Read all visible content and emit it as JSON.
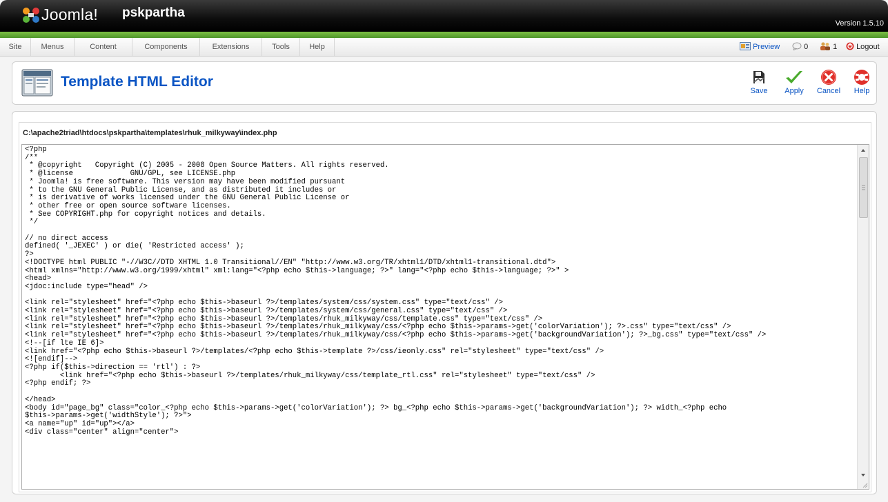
{
  "header": {
    "logo_text": "Joomla!",
    "site_name": "pskpartha",
    "version": "Version 1.5.10"
  },
  "menu": {
    "items": [
      "Site",
      "Menus",
      "Content",
      "Components",
      "Extensions",
      "Tools",
      "Help"
    ]
  },
  "status": {
    "preview_label": "Preview",
    "messages_count": "0",
    "users_online_count": "1",
    "logout_label": "Logout"
  },
  "toolbar": {
    "title": "Template HTML Editor",
    "buttons": {
      "save": "Save",
      "apply": "Apply",
      "cancel": "Cancel",
      "help": "Help"
    }
  },
  "editor": {
    "file_path": "C:\\apache2triad\\htdocs\\pskpartha\\templates\\rhuk_milkyway\\index.php",
    "content": "<?php\n/**\n * @copyright   Copyright (C) 2005 - 2008 Open Source Matters. All rights reserved.\n * @license             GNU/GPL, see LICENSE.php\n * Joomla! is free software. This version may have been modified pursuant\n * to the GNU General Public License, and as distributed it includes or\n * is derivative of works licensed under the GNU General Public License or\n * other free or open source software licenses.\n * See COPYRIGHT.php for copyright notices and details.\n */\n\n// no direct access\ndefined( '_JEXEC' ) or die( 'Restricted access' );\n?>\n<!DOCTYPE html PUBLIC \"-//W3C//DTD XHTML 1.0 Transitional//EN\" \"http://www.w3.org/TR/xhtml1/DTD/xhtml1-transitional.dtd\">\n<html xmlns=\"http://www.w3.org/1999/xhtml\" xml:lang=\"<?php echo $this->language; ?>\" lang=\"<?php echo $this->language; ?>\" >\n<head>\n<jdoc:include type=\"head\" />\n\n<link rel=\"stylesheet\" href=\"<?php echo $this->baseurl ?>/templates/system/css/system.css\" type=\"text/css\" />\n<link rel=\"stylesheet\" href=\"<?php echo $this->baseurl ?>/templates/system/css/general.css\" type=\"text/css\" />\n<link rel=\"stylesheet\" href=\"<?php echo $this->baseurl ?>/templates/rhuk_milkyway/css/template.css\" type=\"text/css\" />\n<link rel=\"stylesheet\" href=\"<?php echo $this->baseurl ?>/templates/rhuk_milkyway/css/<?php echo $this->params->get('colorVariation'); ?>.css\" type=\"text/css\" />\n<link rel=\"stylesheet\" href=\"<?php echo $this->baseurl ?>/templates/rhuk_milkyway/css/<?php echo $this->params->get('backgroundVariation'); ?>_bg.css\" type=\"text/css\" />\n<!--[if lte IE 6]>\n<link href=\"<?php echo $this->baseurl ?>/templates/<?php echo $this->template ?>/css/ieonly.css\" rel=\"stylesheet\" type=\"text/css\" />\n<![endif]-->\n<?php if($this->direction == 'rtl') : ?>\n        <link href=\"<?php echo $this->baseurl ?>/templates/rhuk_milkyway/css/template_rtl.css\" rel=\"stylesheet\" type=\"text/css\" />\n<?php endif; ?>\n\n</head>\n<body id=\"page_bg\" class=\"color_<?php echo $this->params->get('colorVariation'); ?> bg_<?php echo $this->params->get('backgroundVariation'); ?> width_<?php echo\n$this->params->get('widthStyle'); ?>\">\n<a name=\"up\" id=\"up\"></a>\n<div class=\"center\" align=\"center\">"
  },
  "colors": {
    "accent_blue": "#0b55c4",
    "header_green": "#5aa530",
    "header_dark": "#000000"
  }
}
